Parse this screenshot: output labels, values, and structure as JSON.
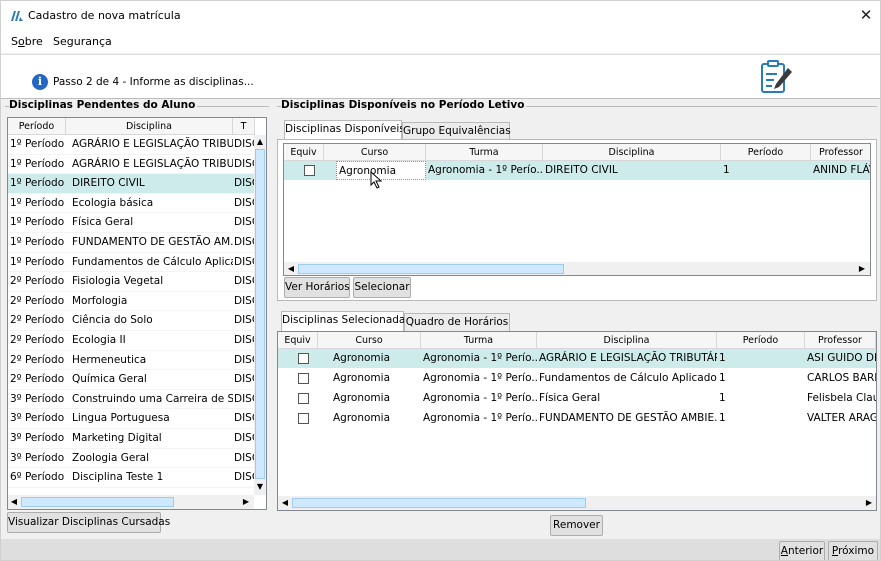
{
  "window": {
    "title": "Cadastro de nova matrícula",
    "close_label": "✕"
  },
  "menu": {
    "items": [
      "Sobre",
      "Segurança"
    ]
  },
  "wizard": {
    "step_text": "Passo 2 de 4 - Informe as disciplinas..."
  },
  "pending": {
    "group_title": "Disciplinas Pendentes do Aluno",
    "columns": [
      "Período",
      "Disciplina",
      "T"
    ],
    "selected_index": 2,
    "rows": [
      {
        "periodo": "1º Período",
        "disciplina": "AGRÁRIO E LEGISLAÇÃO TRIBU...",
        "t": "DISC"
      },
      {
        "periodo": "1º Período",
        "disciplina": "AGRÁRIO E LEGISLAÇÃO TRIBU...",
        "t": "DISC"
      },
      {
        "periodo": "1º Período",
        "disciplina": "DIREITO CIVIL",
        "t": "DISC"
      },
      {
        "periodo": "1º Período",
        "disciplina": "Ecologia básica",
        "t": "DISC"
      },
      {
        "periodo": "1º Período",
        "disciplina": "Física Geral",
        "t": "DISC"
      },
      {
        "periodo": "1º Período",
        "disciplina": "FUNDAMENTO DE GESTÃO AM...",
        "t": "DISC"
      },
      {
        "periodo": "1º Período",
        "disciplina": "Fundamentos de Cálculo Aplica...",
        "t": "DISC"
      },
      {
        "periodo": "2º Período",
        "disciplina": "Fisiologia Vegetal",
        "t": "DISC"
      },
      {
        "periodo": "2º Período",
        "disciplina": "Morfologia",
        "t": "DISC"
      },
      {
        "periodo": "2º Período",
        "disciplina": "Ciência do Solo",
        "t": "DISC"
      },
      {
        "periodo": "2º Período",
        "disciplina": "Ecologia II",
        "t": "DISC"
      },
      {
        "periodo": "2º Período",
        "disciplina": "Hermeneutica",
        "t": "DISC"
      },
      {
        "periodo": "2º Período",
        "disciplina": "Química Geral",
        "t": "DISC"
      },
      {
        "periodo": "3º Período",
        "disciplina": "Construindo uma Carreira de S...",
        "t": "DISC"
      },
      {
        "periodo": "3º Período",
        "disciplina": "Lingua Portuguesa",
        "t": "DISC"
      },
      {
        "periodo": "3º Período",
        "disciplina": "Marketing Digital",
        "t": "DISC"
      },
      {
        "periodo": "3º Período",
        "disciplina": "Zoologia Geral",
        "t": "DISC"
      },
      {
        "periodo": "6º Período",
        "disciplina": "Disciplina Teste 1",
        "t": "DISC"
      }
    ],
    "view_button": "Visualizar Disciplinas Cursadas"
  },
  "available": {
    "group_title": "Disciplinas Disponíveis no Período Letivo",
    "tabs": [
      "Disciplinas Disponíveis",
      "Grupo Equivalências"
    ],
    "active_tab": 0,
    "columns": [
      "Equiv",
      "Curso",
      "Turma",
      "Disciplina",
      "Período",
      "Professor"
    ],
    "rows": [
      {
        "equiv": false,
        "curso": "Agronomia",
        "turma": "Agronomia - 1º Perío...",
        "disciplina": "DIREITO CIVIL",
        "periodo": "1",
        "professor": "ANIND FLÁV"
      }
    ],
    "buttons": {
      "horarios": "Ver Horários",
      "selecionar": "Selecionar"
    }
  },
  "selected": {
    "tabs": [
      "Disciplinas Selecionadas",
      "Quadro de Horários"
    ],
    "active_tab": 0,
    "columns": [
      "Equiv",
      "Curso",
      "Turma",
      "Disciplina",
      "Período",
      "Professor"
    ],
    "selected_index": 0,
    "rows": [
      {
        "equiv": false,
        "curso": "Agronomia",
        "turma": "Agronomia - 1º Perío...",
        "disciplina": "AGRÁRIO E LEGISLAÇÃO TRIBUTÁRIA",
        "periodo": "1",
        "professor": "ASI GUIDO DIA"
      },
      {
        "equiv": false,
        "curso": "Agronomia",
        "turma": "Agronomia - 1º Perío...",
        "disciplina": "Fundamentos de Cálculo Aplicado",
        "periodo": "1",
        "professor": "CARLOS BARB"
      },
      {
        "equiv": false,
        "curso": "Agronomia",
        "turma": "Agronomia - 1º Perío...",
        "disciplina": "Física Geral",
        "periodo": "1",
        "professor": "Felisbela Clauc"
      },
      {
        "equiv": false,
        "curso": "Agronomia",
        "turma": "Agronomia - 1º Perío...",
        "disciplina": "FUNDAMENTO DE GESTÃO AMBIE...",
        "periodo": "1",
        "professor": "VALTER ARAGÃ"
      }
    ],
    "remove_button": "Remover"
  },
  "nav": {
    "prev": "Anterior",
    "next": "Próximo"
  },
  "colors": {
    "selection": "#cdebea",
    "info_blue": "#2566c4",
    "scroll_thumb": "#cde8ff"
  }
}
